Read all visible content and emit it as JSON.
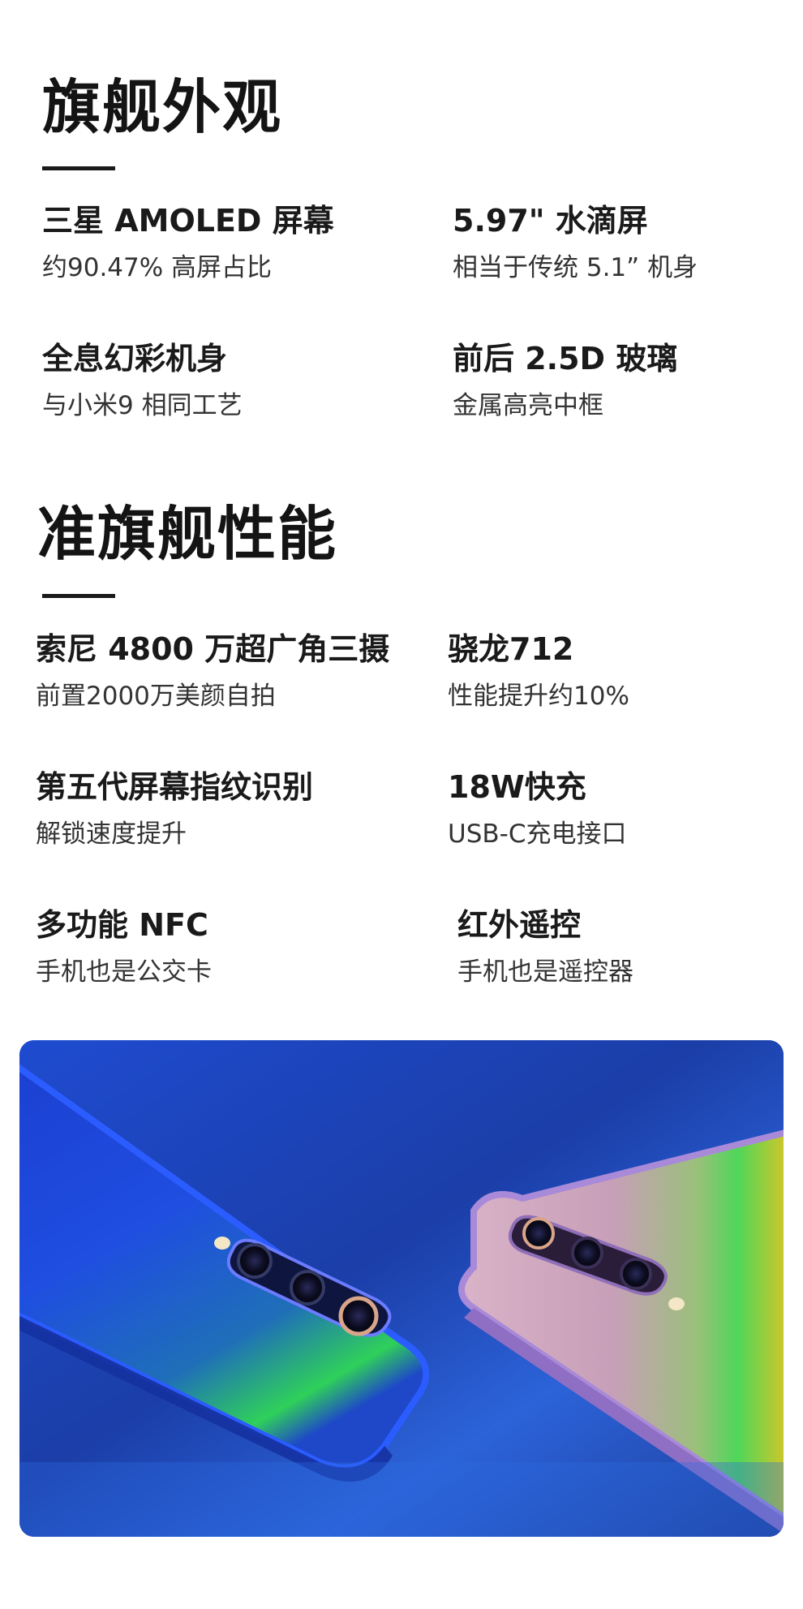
{
  "sections": [
    {
      "title": "旗舰外观",
      "features": [
        {
          "title": "三星 AMOLED 屏幕",
          "sub": "约90.47% 高屏占比"
        },
        {
          "title": "5.97\" 水滴屏",
          "sub": "相当于传统 5.1” 机身"
        },
        {
          "title": "全息幻彩机身",
          "sub": "与小米9 相同工艺"
        },
        {
          "title": "前后 2.5D 玻璃",
          "sub": "金属高亮中框"
        }
      ]
    },
    {
      "title": "准旗舰性能",
      "features": [
        {
          "title": "索尼 4800 万超广角三摄",
          "sub": "前置2000万美颜自拍"
        },
        {
          "title": "骁龙712",
          "sub": "性能提升约10%"
        },
        {
          "title": "第五代屏幕指纹识别",
          "sub": "解锁速度提升"
        },
        {
          "title": "18W快充",
          "sub": "USB-C充电接口"
        },
        {
          "title": "多功能 NFC",
          "sub": "手机也是公交卡"
        },
        {
          "title": "红外遥控",
          "sub": "手机也是遥控器"
        }
      ]
    }
  ],
  "colors": {
    "banner_blue": "#1d47c9",
    "phone_blue": "#1f4ad6",
    "phone_purple": "#b58fd0",
    "holo_green": "#3fd64a",
    "holo_yellow": "#f2c21a"
  }
}
